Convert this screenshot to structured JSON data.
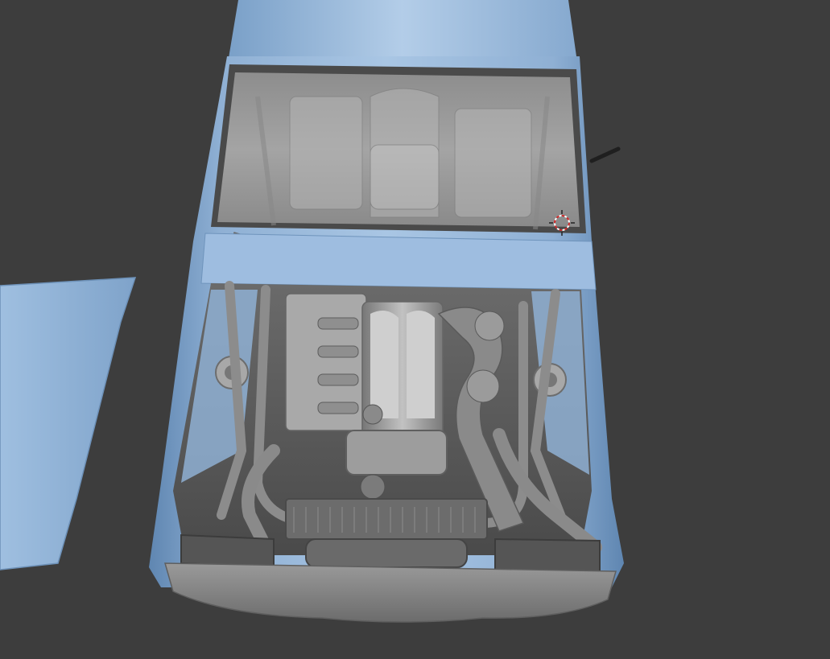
{
  "viewport": {
    "background": "#3d3d3d",
    "scene": "car-front-engine-bay-model",
    "colors": {
      "body_light": "#a9c6e4",
      "body_mid": "#86a9cf",
      "body_dark": "#5f86b1",
      "metal_light": "#b8b8b8",
      "metal_mid": "#8e8e8e",
      "metal_dark": "#5a5a5a",
      "glass": "#9a9a9a",
      "cursor": "#d22a2a"
    },
    "icons": {
      "cursor": "3d-cursor-icon"
    }
  }
}
